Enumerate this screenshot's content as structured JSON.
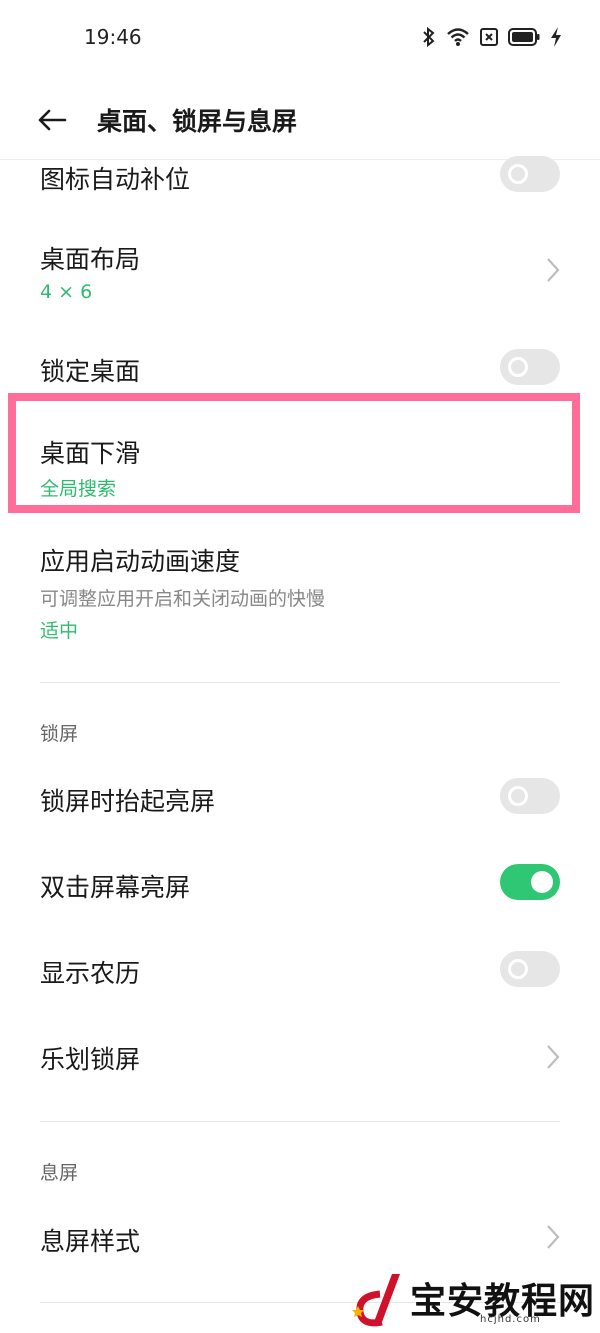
{
  "status_bar": {
    "time": "19:46",
    "icons": [
      "bluetooth-icon",
      "wifi-icon",
      "sim-off-icon",
      "battery-icon",
      "charging-icon"
    ]
  },
  "app_bar": {
    "title": "桌面、锁屏与息屏",
    "back_icon": "arrow-left-icon"
  },
  "desktop_section": {
    "items": [
      {
        "title": "图标自动补位",
        "control": "toggle",
        "on": false
      },
      {
        "title": "桌面布局",
        "value": "4 × 6",
        "control": "chevron"
      },
      {
        "title": "锁定桌面",
        "control": "toggle",
        "on": false
      },
      {
        "title": "桌面下滑",
        "value": "全局搜索",
        "control": "none"
      },
      {
        "title": "应用启动动画速度",
        "subtitle": "可调整应用开启和关闭动画的快慢",
        "value": "适中",
        "control": "none"
      }
    ]
  },
  "lock_section": {
    "header": "锁屏",
    "items": [
      {
        "title": "锁屏时抬起亮屏",
        "control": "toggle",
        "on": false
      },
      {
        "title": "双击屏幕亮屏",
        "control": "toggle",
        "on": true
      },
      {
        "title": "显示农历",
        "control": "toggle",
        "on": false
      },
      {
        "title": "乐划锁屏",
        "control": "chevron"
      }
    ]
  },
  "aod_section": {
    "header": "息屏",
    "items": [
      {
        "title": "息屏样式",
        "control": "chevron"
      }
    ]
  },
  "watermark": {
    "text": "宝安教程网",
    "url": "hcjhd.com"
  },
  "colors": {
    "accent": "#2fbb6e",
    "toggle_on": "#2fc774",
    "toggle_off": "#e6e6e6",
    "highlight": "#ff6e9a"
  }
}
